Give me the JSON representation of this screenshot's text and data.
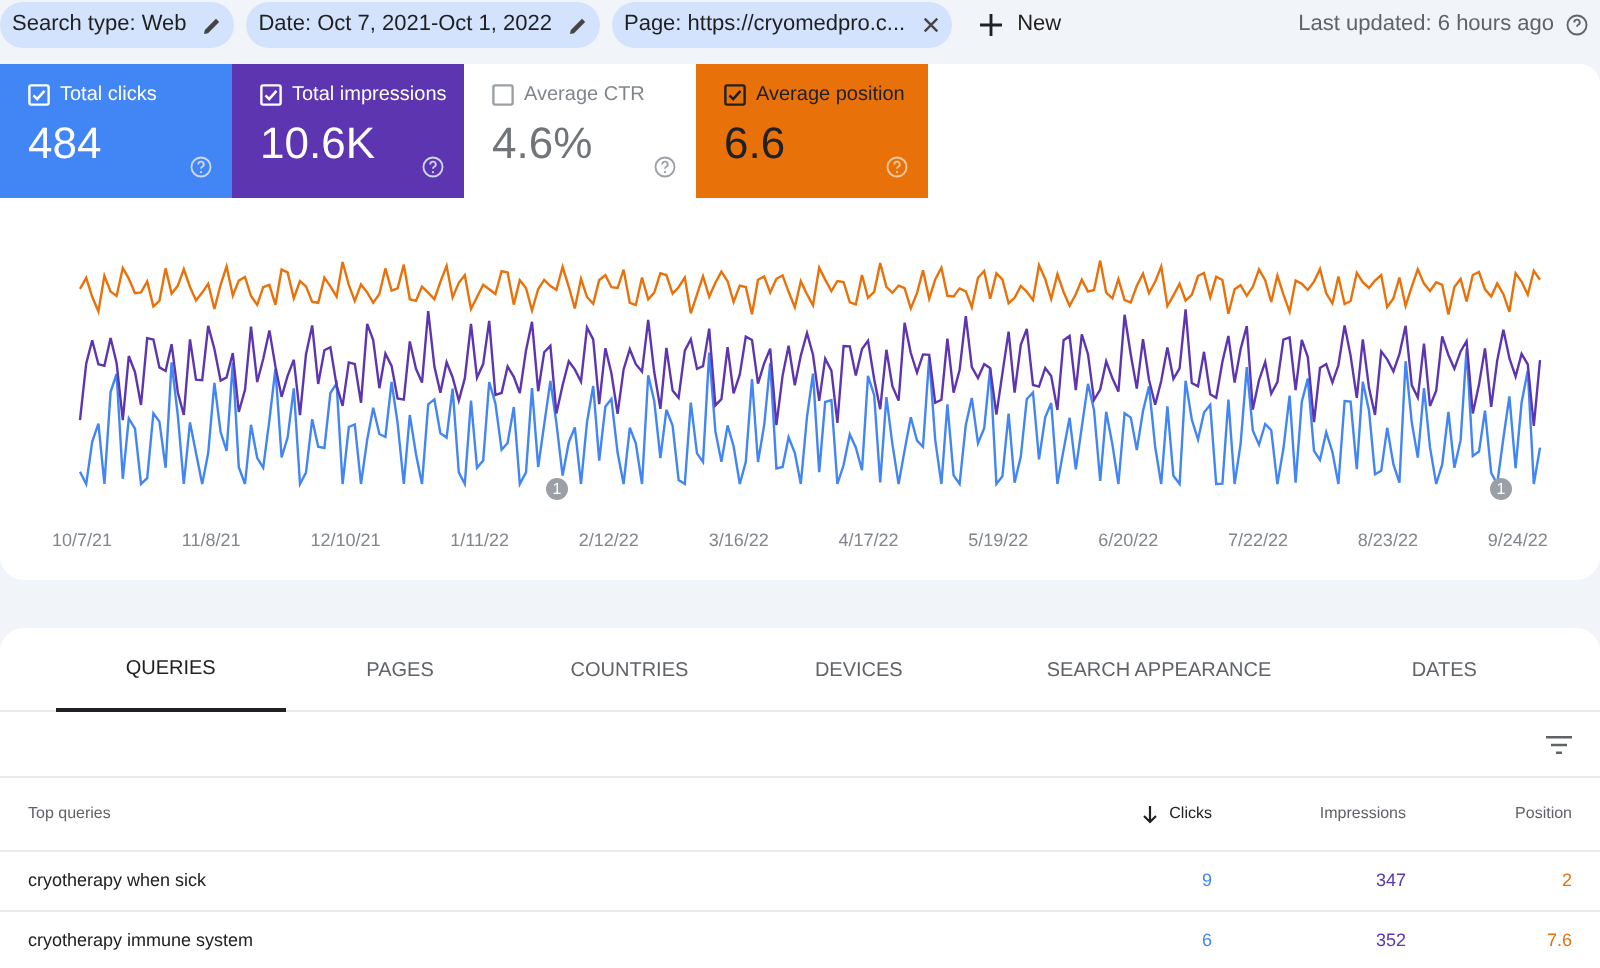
{
  "filters": [
    {
      "label": "Search type: Web",
      "kind": "edit"
    },
    {
      "label": "Date: Oct 7, 2021-Oct 1, 2022",
      "kind": "edit"
    },
    {
      "label": "Page: https://cryomedpro.c...",
      "kind": "remove"
    }
  ],
  "new_button": "New",
  "last_updated": "Last updated: 6 hours ago",
  "metrics": [
    {
      "label": "Total clicks",
      "value": "484",
      "checked": true,
      "color": "#4285f4"
    },
    {
      "label": "Total impressions",
      "value": "10.6K",
      "checked": true,
      "color": "#5e35b1"
    },
    {
      "label": "Average CTR",
      "value": "4.6%",
      "checked": false
    },
    {
      "label": "Average position",
      "value": "6.6",
      "checked": true,
      "color": "#e8710a"
    }
  ],
  "chart": {
    "x_labels": [
      "10/7/21",
      "11/8/21",
      "12/10/21",
      "1/11/22",
      "2/12/22",
      "3/16/22",
      "4/17/22",
      "5/19/22",
      "6/20/22",
      "7/22/22",
      "8/23/22",
      "9/24/22"
    ],
    "annotations": [
      {
        "label": "1"
      },
      {
        "label": "1"
      }
    ]
  },
  "tabs": [
    {
      "label": "QUERIES",
      "selected": true
    },
    {
      "label": "PAGES",
      "selected": false
    },
    {
      "label": "COUNTRIES",
      "selected": false
    },
    {
      "label": "DEVICES",
      "selected": false
    },
    {
      "label": "SEARCH APPEARANCE",
      "selected": false
    },
    {
      "label": "DATES",
      "selected": false
    }
  ],
  "table": {
    "columns": [
      "Top queries",
      "Clicks",
      "Impressions",
      "Position"
    ],
    "rows": [
      [
        "cryotherapy when sick",
        "9",
        "347",
        "2"
      ],
      [
        "cryotherapy immune system",
        "6",
        "352",
        "7.6"
      ]
    ]
  }
}
